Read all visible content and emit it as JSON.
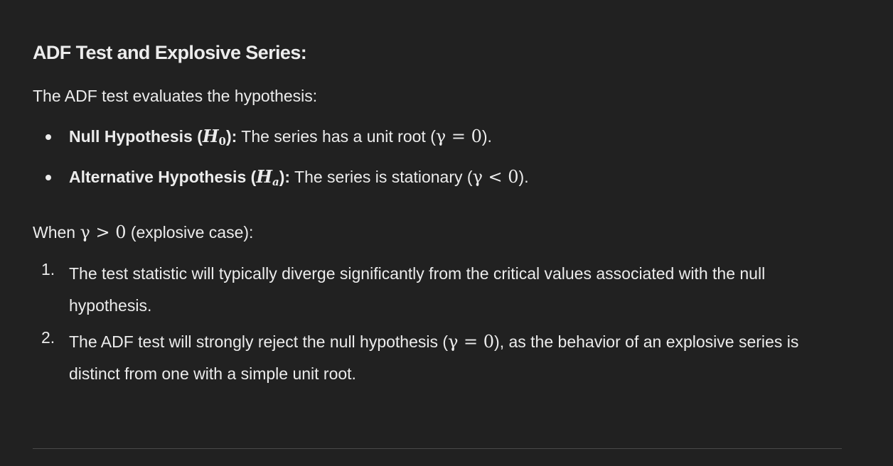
{
  "heading": "ADF Test and Explosive Series:",
  "intro": "The ADF test evaluates the hypothesis:",
  "bullets": [
    {
      "label_pre": "Null Hypothesis (",
      "math_var": "H",
      "math_sub": "0",
      "label_post": "):",
      "text_pre": " The series has a unit root (",
      "math_expr": "γ = 0",
      "text_post": ")."
    },
    {
      "label_pre": "Alternative Hypothesis (",
      "math_var": "H",
      "math_sub": "a",
      "label_post": "):",
      "text_pre": " The series is stationary (",
      "math_expr": "γ < 0",
      "text_post": ")."
    }
  ],
  "when": {
    "pre": "When ",
    "math_expr": "γ > 0",
    "post": " (explosive case):"
  },
  "numbered": [
    {
      "number": "1.",
      "text": "The test statistic will typically diverge significantly from the critical values associated with the null hypothesis."
    },
    {
      "number": "2.",
      "text_pre": "The ADF test will strongly reject the null hypothesis (",
      "math_expr": "γ = 0",
      "text_post": "), as the behavior of an explosive series is distinct from one with a simple unit root."
    }
  ]
}
